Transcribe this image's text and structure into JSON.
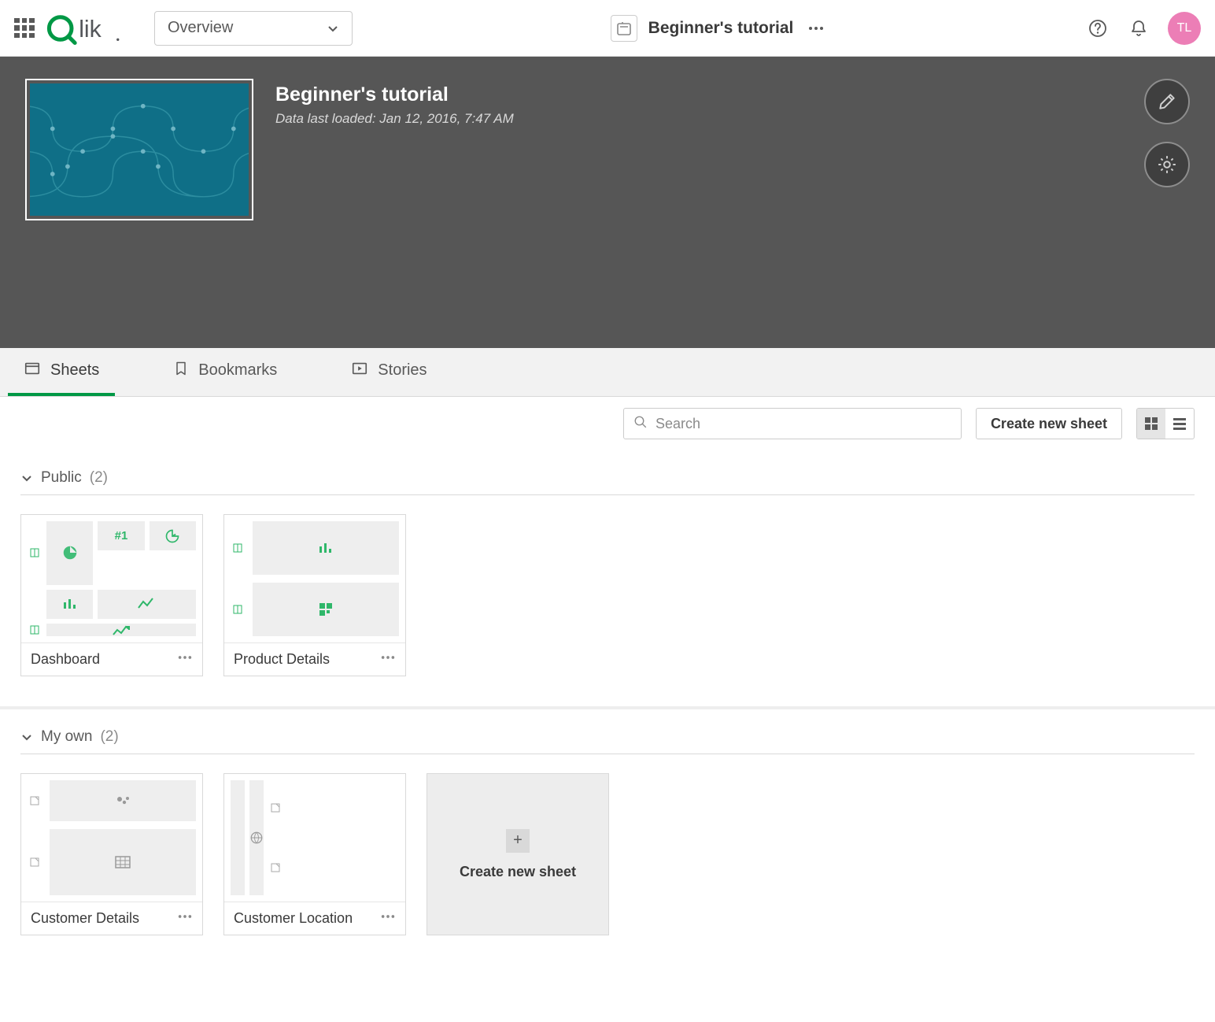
{
  "topbar": {
    "view_select_label": "Overview",
    "app_title": "Beginner's tutorial",
    "avatar_initials": "TL"
  },
  "hero": {
    "title": "Beginner's tutorial",
    "subtitle": "Data last loaded: Jan 12, 2016, 7:47 AM"
  },
  "tabs": {
    "sheets": "Sheets",
    "bookmarks": "Bookmarks",
    "stories": "Stories"
  },
  "toolbar": {
    "search_placeholder": "Search",
    "create_label": "Create new sheet"
  },
  "sections": {
    "public": {
      "label": "Public",
      "count": "(2)"
    },
    "myown": {
      "label": "My own",
      "count": "(2)"
    }
  },
  "cards": {
    "dashboard": "Dashboard",
    "product_details": "Product Details",
    "customer_details": "Customer Details",
    "customer_location": "Customer Location",
    "num1": "#1"
  },
  "create_card": {
    "label": "Create new sheet"
  }
}
